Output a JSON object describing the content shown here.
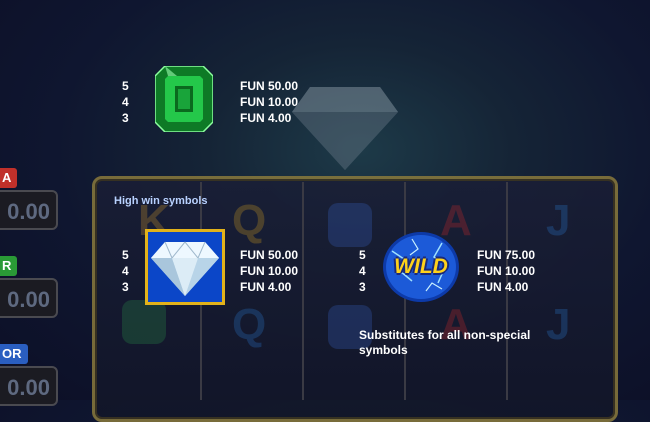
{
  "colors": {
    "highlight_frame": "#e2b21a",
    "emerald": "#1fbf3e",
    "wild_blue": "#1c5ad8",
    "wild_text": "#ffd21a",
    "section_label": "#b9d2ff"
  },
  "background": {
    "side_tags": [
      "A",
      "R",
      "OR"
    ],
    "side_values": [
      "0.00",
      "0.00",
      "0.00"
    ],
    "reel_letters": [
      "K",
      "Q",
      "A",
      "J",
      "Q",
      "A",
      "J"
    ]
  },
  "paytable": {
    "emerald": {
      "icon": "emerald-icon",
      "counts": [
        "5",
        "4",
        "3"
      ],
      "payouts": [
        "FUN 50.00",
        "FUN 10.00",
        "FUN 4.00"
      ]
    },
    "section_title": "High win symbols",
    "diamond": {
      "icon": "diamond-icon",
      "counts": [
        "5",
        "4",
        "3"
      ],
      "payouts": [
        "FUN 50.00",
        "FUN 10.00",
        "FUN 4.00"
      ]
    },
    "wild": {
      "icon": "wild-icon",
      "label": "WILD",
      "counts": [
        "5",
        "4",
        "3"
      ],
      "payouts": [
        "FUN 75.00",
        "FUN 10.00",
        "FUN 4.00"
      ],
      "description": "Substitutes for all non-special symbols"
    }
  }
}
